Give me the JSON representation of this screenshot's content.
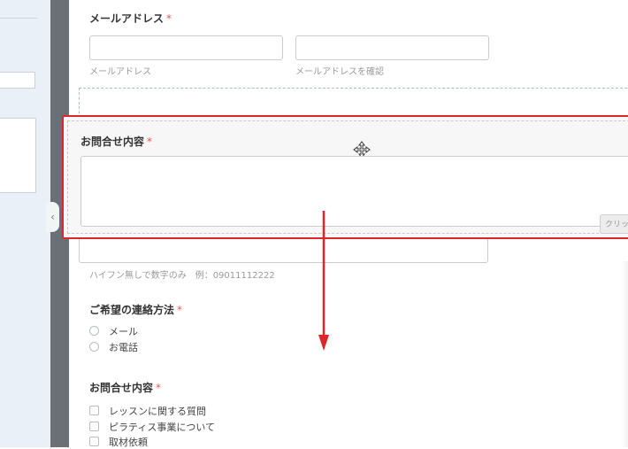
{
  "form": {
    "email": {
      "label": "メールアドレス",
      "required": "*",
      "hint": "メールアドレス",
      "confirm_hint": "メールアドレスを確認"
    },
    "inquiry_block": {
      "label": "お問合せ内容",
      "required": "*",
      "button_label": "クリック"
    },
    "phone": {
      "hint": "ハイフン無しで数字のみ　例：09011112222"
    },
    "contact_method": {
      "label": "ご希望の連絡方法",
      "required": "*",
      "options": [
        "メール",
        "お電話"
      ]
    },
    "inquiry_type": {
      "label": "お問合せ内容",
      "required": "*",
      "options": [
        "レッスンに関する質問",
        "ピラティス事業について",
        "取材依頼"
      ]
    }
  },
  "icons": {
    "move": "move-arrows-icon",
    "collapse": "chevron-left-icon",
    "arrow": "down-arrow-icon"
  },
  "colors": {
    "highlight": "#e0242b",
    "required": "#e05a5a",
    "separator": "#6b7077"
  }
}
